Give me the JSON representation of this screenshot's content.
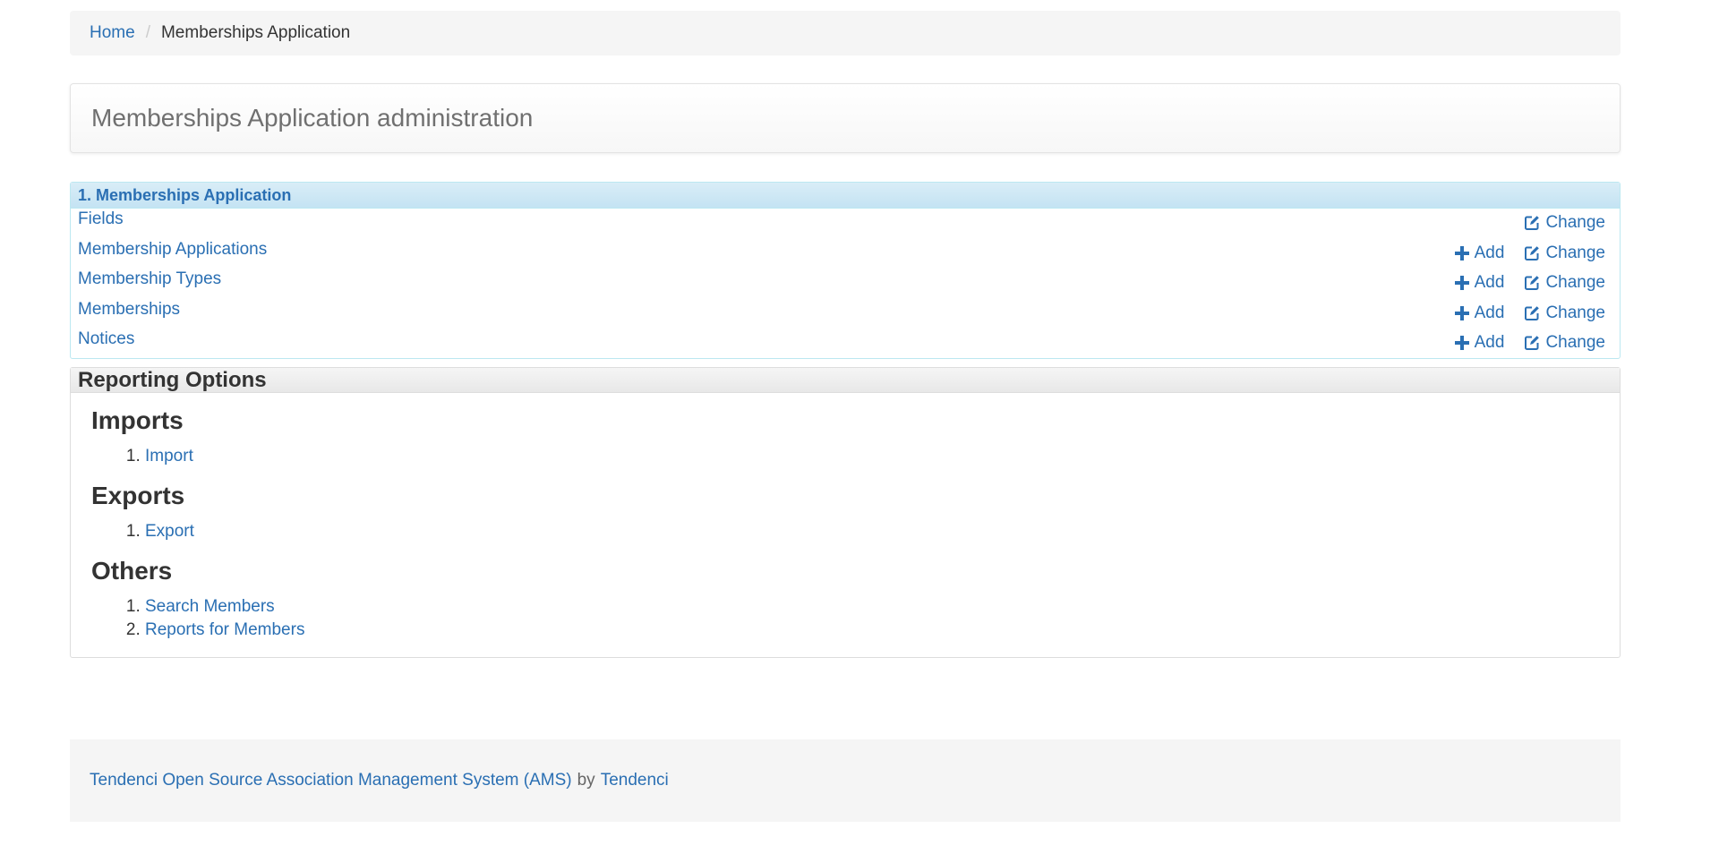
{
  "breadcrumb": {
    "home": "Home",
    "separator": "/",
    "current": "Memberships Application"
  },
  "page_title": "Memberships Application administration",
  "app_module": {
    "caption": "1. Memberships Application",
    "add_label": "Add",
    "change_label": "Change",
    "models": [
      {
        "name": "Fields",
        "has_add": false
      },
      {
        "name": "Membership Applications",
        "has_add": true
      },
      {
        "name": "Membership Types",
        "has_add": true
      },
      {
        "name": "Memberships",
        "has_add": true
      },
      {
        "name": "Notices",
        "has_add": true
      }
    ]
  },
  "reporting": {
    "caption": "Reporting Options",
    "imports": {
      "heading": "Imports",
      "items": [
        "Import"
      ]
    },
    "exports": {
      "heading": "Exports",
      "items": [
        "Export"
      ]
    },
    "others": {
      "heading": "Others",
      "items": [
        "Search Members",
        "Reports for Members"
      ]
    }
  },
  "footer": {
    "product_link": "Tendenci Open Source Association Management System (AMS)",
    "by": "by",
    "company_link": "Tendenci"
  },
  "colors": {
    "link": "#2a6fb3",
    "module_header_bg": "#d9edf7",
    "module_border": "#bce8f1",
    "panel_bg": "#f5f5f5"
  }
}
